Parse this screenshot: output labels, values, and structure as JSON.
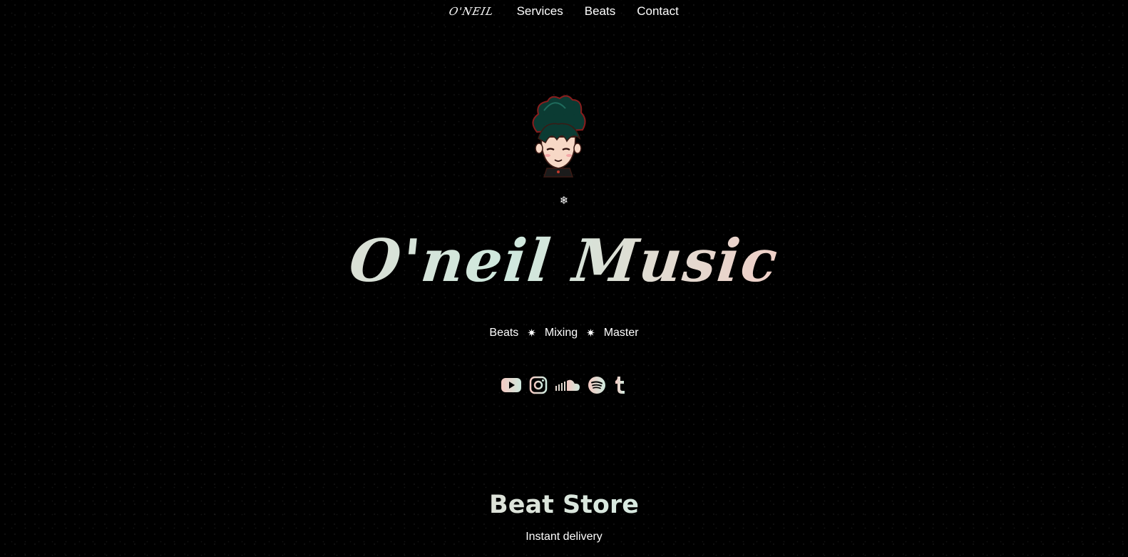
{
  "nav": {
    "logo": "O'NEIL",
    "links": [
      "Services",
      "Beats",
      "Contact"
    ]
  },
  "hero": {
    "snowflake": "❄",
    "title": "O'neil Music",
    "tagline": [
      "Beats",
      "Mixing",
      "Master"
    ],
    "separator": "✷"
  },
  "socials": [
    "youtube-icon",
    "instagram-icon",
    "soundcloud-icon",
    "spotify-icon",
    "tumblr-icon"
  ],
  "store": {
    "title": "Beat Store",
    "subtitle": "Instant delivery"
  },
  "colors": {
    "background": "#000000",
    "accent_pink": "#f4c9c2",
    "accent_mint": "#cfe9de"
  }
}
